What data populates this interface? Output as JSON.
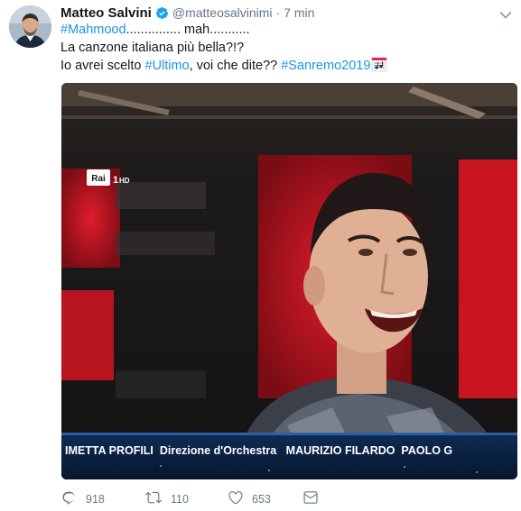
{
  "tweet": {
    "author": {
      "display_name": "Matteo Salvini",
      "handle": "@matteosalvinimi",
      "verified": true
    },
    "separator": "·",
    "timestamp": "7 min",
    "text": {
      "line1_hashtag": "#Mahmood",
      "line1_rest": "............... mah...........",
      "line2": "La canzone italiana più bella?!?",
      "line3_prefix": "Io avrei scelto ",
      "line3_hashtag": "#Ultimo",
      "line3_middle": ", voi che dite?? ",
      "line3_hashtag2": "#Sanremo2019",
      "line3_emoji": "musical-score-emoji"
    },
    "media": {
      "channel_logo": "Rai",
      "channel_number": "1",
      "channel_quality": "HD",
      "caption": "IMETTA PROFILI  Direzione d'Orchestra   MAURIZIO FILARDO  PAOLO G"
    },
    "actions": {
      "replies": "918",
      "retweets": "110",
      "likes": "653"
    },
    "colors": {
      "link": "#1b95e0",
      "muted": "#657786",
      "verified": "#1da1f2"
    }
  }
}
